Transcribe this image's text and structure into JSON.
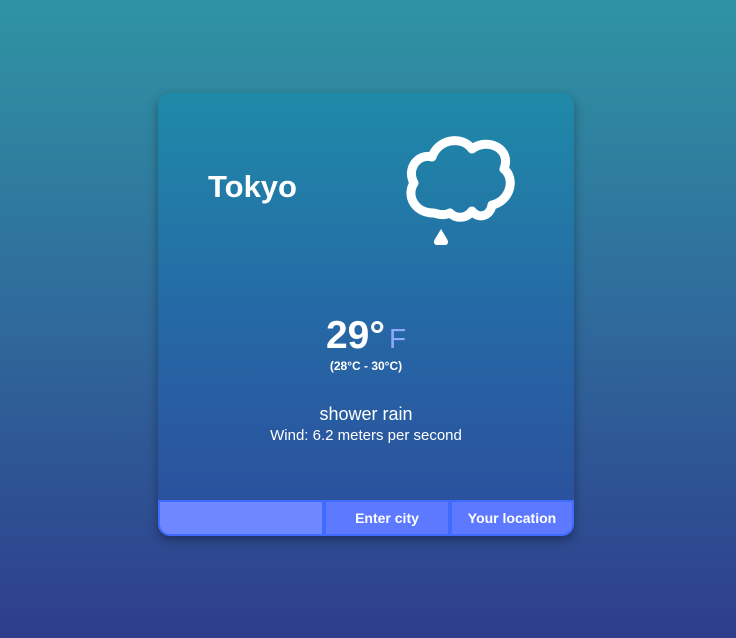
{
  "weather": {
    "city": "Tokyo",
    "icon": "shower-rain-icon",
    "temperature": "29°",
    "unit": "F",
    "range": "(28°C - 30°C)",
    "description": "shower rain",
    "wind": "Wind: 6.2 meters per second"
  },
  "controls": {
    "city_input_value": "",
    "city_input_placeholder": "",
    "enter_city_label": "Enter city",
    "your_location_label": "Your location"
  },
  "colors": {
    "accent": "#5c79ff",
    "input_bg": "#7088ff",
    "unit_color": "#8fa8ff"
  }
}
